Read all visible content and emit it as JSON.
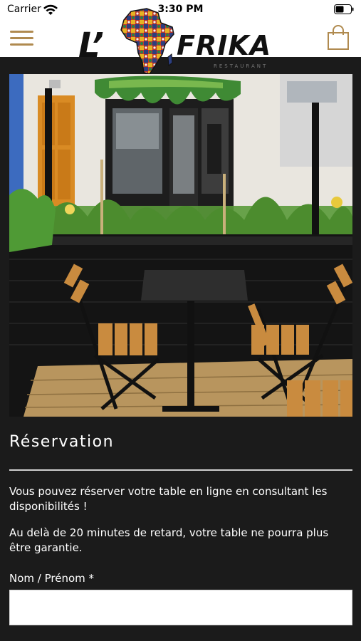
{
  "status_bar": {
    "carrier": "Carrier",
    "time": "3:30 PM",
    "wifi_icon": "wifi-icon",
    "battery_icon": "battery-icon"
  },
  "header": {
    "menu_icon": "hamburger-menu-icon",
    "logo": {
      "prefix": "L’",
      "name": "FRIKA",
      "subtitle": "RESTAURANT"
    },
    "cart_icon": "shopping-bag-icon",
    "accent_color": "#b08a4f"
  },
  "hero": {
    "description_icon": "restaurant-terrace-photo"
  },
  "reservation": {
    "title": "Réservation",
    "paragraph_1": "Vous pouvez réserver votre table en ligne en consultant les disponibilités !",
    "paragraph_2": "Au delà de 20 minutes de retard, votre table ne pourra plus être garantie.",
    "name_field": {
      "label": "Nom / Prénom *",
      "value": "",
      "placeholder": ""
    }
  },
  "colors": {
    "background": "#1b1b1b",
    "text": "#ffffff",
    "header_bg": "#ffffff"
  }
}
